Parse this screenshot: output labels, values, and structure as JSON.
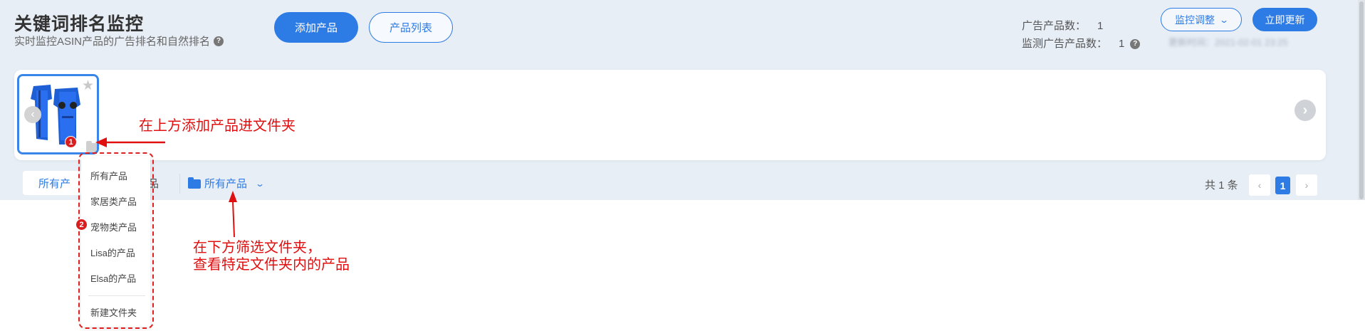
{
  "header": {
    "title": "关键词排名监控",
    "subtitle": "实时监控ASIN产品的广告排名和自然排名",
    "add_product_label": "添加产品",
    "product_list_label": "产品列表"
  },
  "stats": {
    "ad_products_label": "广告产品数：",
    "ad_products_value": "1",
    "monitored_label": "监测广告产品数：",
    "monitored_value": "1",
    "update_time": "更新时间：2021-02-01 23:25"
  },
  "actions": {
    "monitor_adjust_label": "监控调整",
    "update_now_label": "立即更新"
  },
  "filters": {
    "tab_all": "所有产",
    "tab_second": "品",
    "folder_filter_label": "所有产品"
  },
  "pagination": {
    "total": "共 1 条",
    "current_page": "1"
  },
  "folder_menu": {
    "items": [
      "所有产品",
      "家居类产品",
      "宠物类产品",
      "Lisa的产品",
      "Elsa的产品"
    ],
    "new_folder_label": "新建文件夹"
  },
  "annotations": {
    "step1_badge": "1",
    "step2_badge": "2",
    "add_hint": "在上方添加产品进文件夹",
    "filter_hint_line1": "在下方筛选文件夹，",
    "filter_hint_line2": "查看特定文件夹内的产品"
  },
  "colors": {
    "accent": "#2d7be5",
    "background": "#e8eef6",
    "annotation": "#e01010"
  },
  "icons": {
    "help": "question-circle-icon",
    "star": "star-icon",
    "folder": "folder-icon",
    "chevron": "chevron-down-icon"
  }
}
